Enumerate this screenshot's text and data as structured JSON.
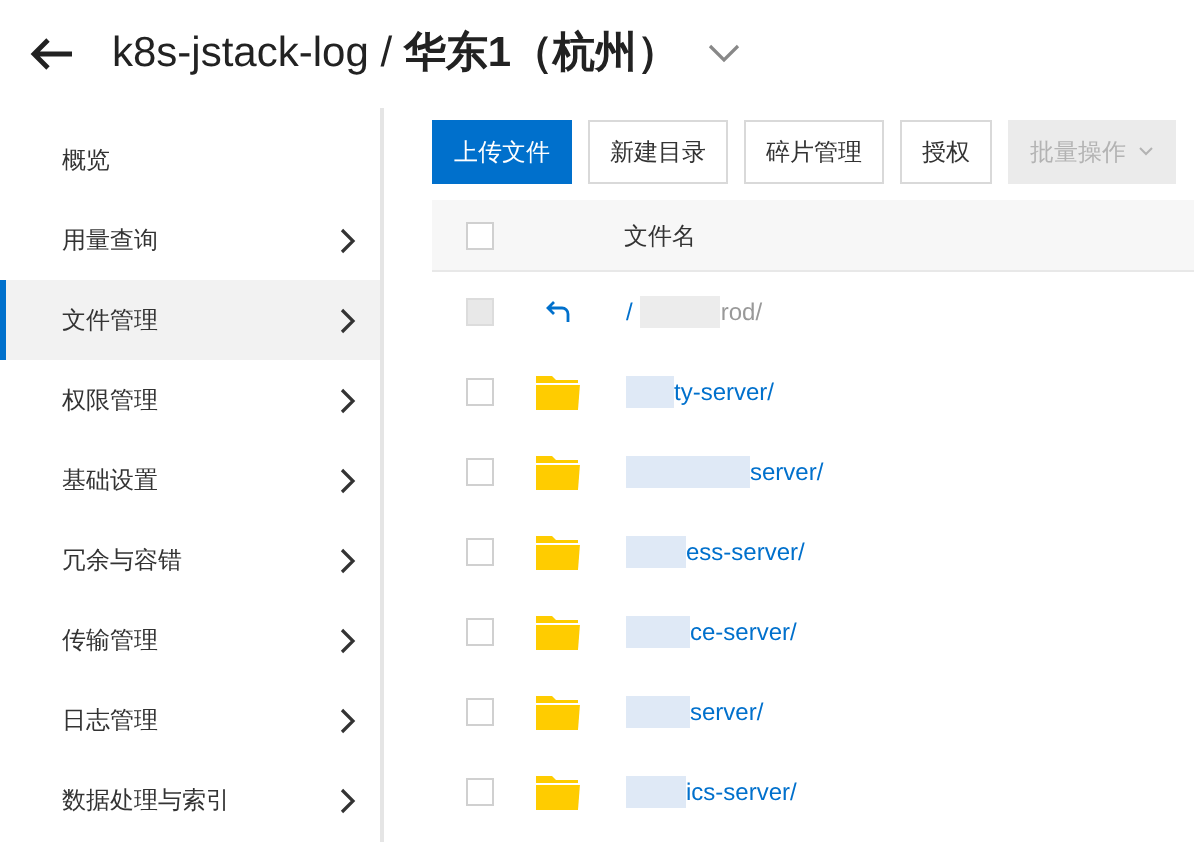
{
  "header": {
    "title": "k8s-jstack-log / ",
    "region": "华东1（杭州）"
  },
  "sidebar": {
    "items": [
      {
        "label": "概览",
        "expandable": false,
        "selected": false
      },
      {
        "label": "用量查询",
        "expandable": true,
        "selected": false
      },
      {
        "label": "文件管理",
        "expandable": true,
        "selected": true
      },
      {
        "label": "权限管理",
        "expandable": true,
        "selected": false
      },
      {
        "label": "基础设置",
        "expandable": true,
        "selected": false
      },
      {
        "label": "冗余与容错",
        "expandable": true,
        "selected": false
      },
      {
        "label": "传输管理",
        "expandable": true,
        "selected": false
      },
      {
        "label": "日志管理",
        "expandable": true,
        "selected": false
      },
      {
        "label": "数据处理与索引",
        "expandable": true,
        "selected": false
      }
    ]
  },
  "toolbar": [
    {
      "label": "上传文件",
      "kind": "primary",
      "disabled": false
    },
    {
      "label": "新建目录",
      "kind": "normal",
      "disabled": false
    },
    {
      "label": "碎片管理",
      "kind": "normal",
      "disabled": false
    },
    {
      "label": "授权",
      "kind": "normal",
      "disabled": false
    },
    {
      "label": "批量操作",
      "kind": "dropdown",
      "disabled": true
    }
  ],
  "table": {
    "select_all": {
      "checked": false
    },
    "columns": [
      "文件名"
    ],
    "rows": [
      {
        "kind": "parent",
        "prefix": "/",
        "name": "rod/",
        "checked": false,
        "disabled": true
      },
      {
        "kind": "folder",
        "name": "ty-server/",
        "checked": false,
        "disabled": false
      },
      {
        "kind": "folder",
        "name": "server/",
        "checked": false,
        "disabled": false
      },
      {
        "kind": "folder",
        "name": "ess-server/",
        "checked": false,
        "disabled": false
      },
      {
        "kind": "folder",
        "name": "ce-server/",
        "checked": false,
        "disabled": false
      },
      {
        "kind": "folder",
        "name": "server/",
        "checked": false,
        "disabled": false
      },
      {
        "kind": "folder",
        "name": "ics-server/",
        "checked": false,
        "disabled": false
      }
    ]
  }
}
